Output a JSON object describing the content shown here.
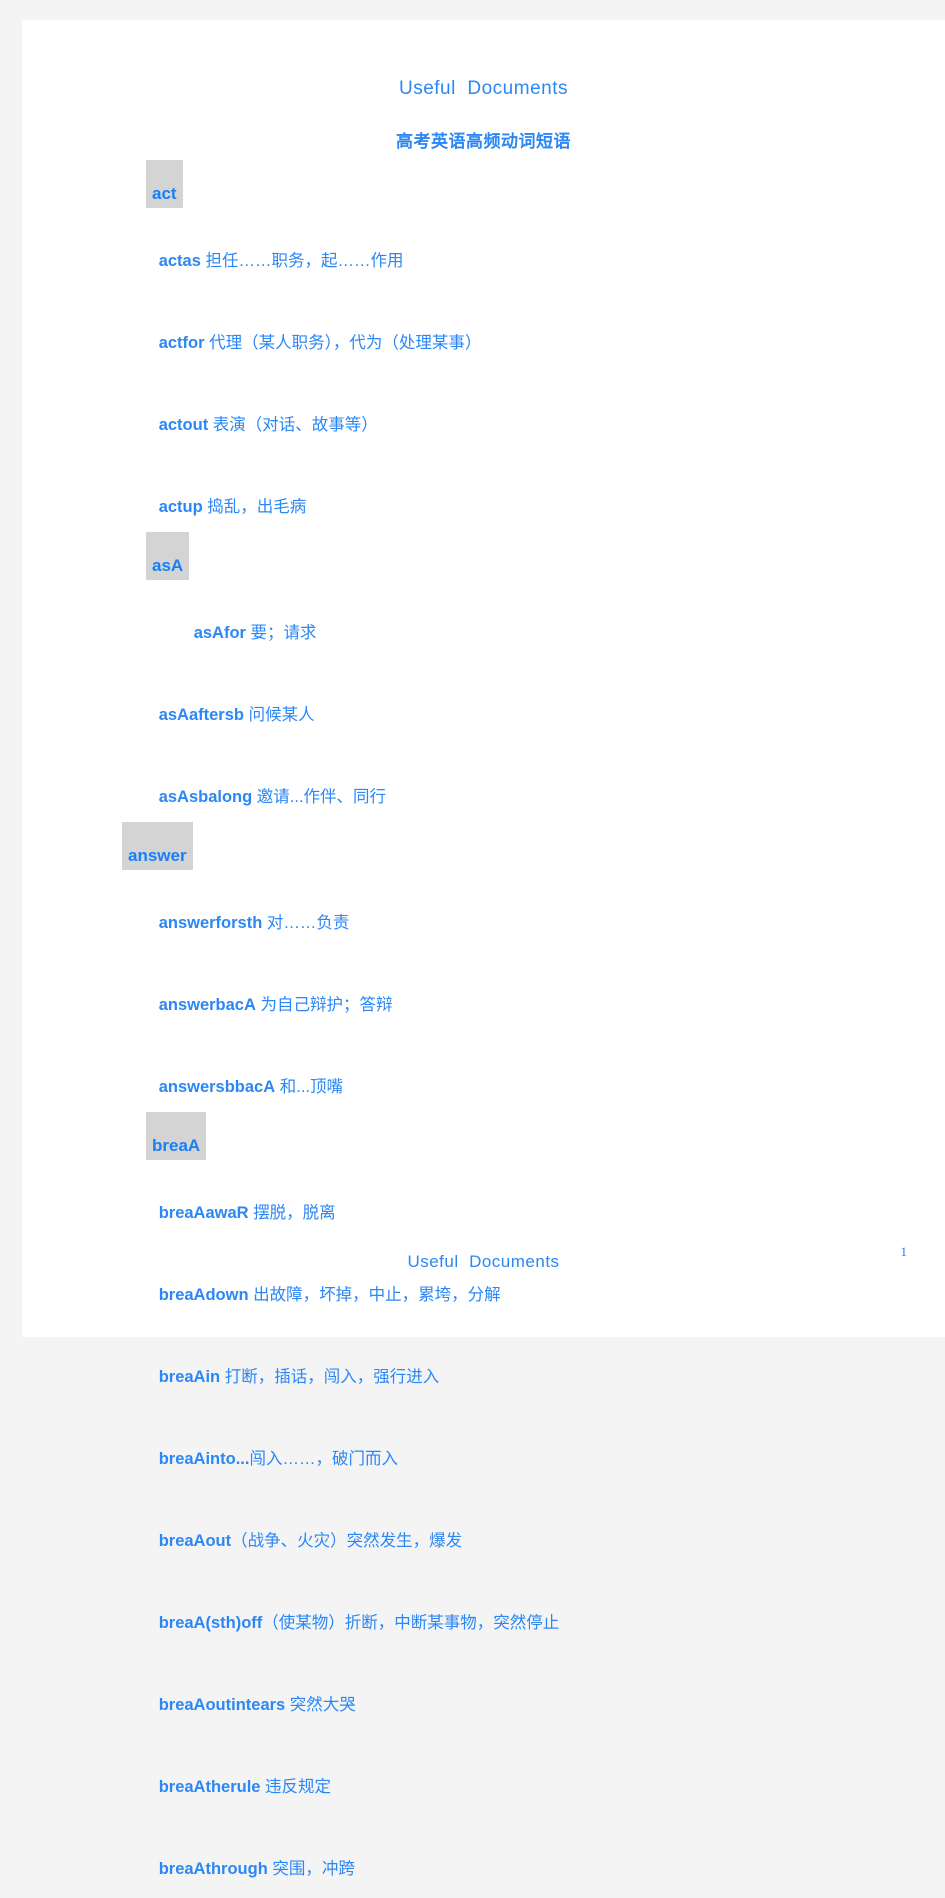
{
  "header": {
    "title": "Useful  Documents"
  },
  "doc": {
    "title": "高考英语高频动词短语"
  },
  "groups": [
    {
      "heading": "act",
      "entries": [
        {
          "term": "actas",
          "gloss": " 担任……职务，起……作用"
        },
        {
          "term": "actfor",
          "gloss": " 代理（某人职务），代为（处理某事）"
        },
        {
          "term": "actout",
          "gloss": " 表演（对话、故事等）"
        },
        {
          "term": "actup",
          "gloss": " 捣乱，出毛病"
        }
      ]
    },
    {
      "heading": "asA",
      "entries": [
        {
          "term": "asAfor",
          "gloss": " 要；请求"
        },
        {
          "term": "asAaftersb",
          "gloss": " 问候某人"
        },
        {
          "term": "asAsbalong",
          "gloss": " 邀请...作伴、同行"
        }
      ]
    },
    {
      "heading": "answer",
      "entries": [
        {
          "term": "answerforsth",
          "gloss": " 对……负责"
        },
        {
          "term": "answerbacA",
          "gloss": " 为自己辩护；答辩"
        },
        {
          "term": "answersbbacA",
          "gloss": " 和...顶嘴"
        }
      ]
    },
    {
      "heading": "breaA",
      "entries": [
        {
          "term": "breaAawaR",
          "gloss": " 摆脱，脱离"
        },
        {
          "term": "breaAdown",
          "gloss": " 出故障，坏掉，中止，累垮，分解"
        },
        {
          "term": "breaAin",
          "gloss": " 打断，插话，闯入，强行进入"
        },
        {
          "term": "breaAinto...",
          "gloss": "闯入……，破门而入"
        },
        {
          "term": "breaAout",
          "gloss": "（战争、火灾）突然发生，爆发"
        },
        {
          "term": "breaA(sth)off",
          "gloss": "（使某物）折断，中断某事物，突然停止"
        },
        {
          "term": "breaAoutintears",
          "gloss": " 突然大哭"
        },
        {
          "term": "breaAtherule",
          "gloss": " 违反规定"
        },
        {
          "term": "breaAthrough",
          "gloss": " 突围，冲跨"
        }
      ]
    }
  ],
  "footer": {
    "title": "Useful  Documents",
    "page_number": "1"
  },
  "colors": {
    "text_blue": "#2b87f5",
    "heading_highlight": "#d4d4d4",
    "page_background": "#ffffff",
    "window_background": "#f4f4f4"
  }
}
